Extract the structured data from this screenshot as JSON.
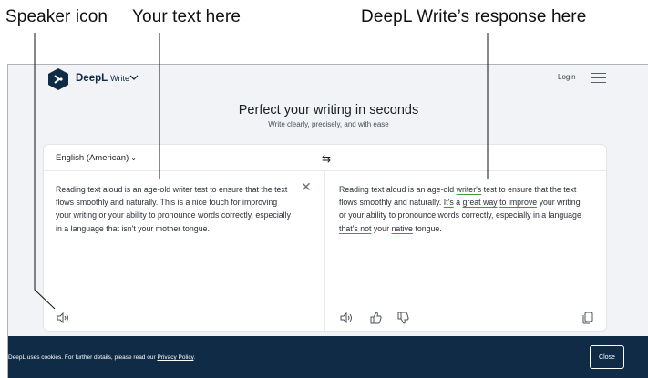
{
  "callouts": {
    "speaker_icon": "Speaker icon",
    "your_text": "Your text here",
    "response": "DeepL Write’s response here"
  },
  "header": {
    "brand": "DeepL",
    "product": "Write",
    "login": "Login"
  },
  "hero": {
    "title": "Perfect your writing in seconds",
    "subtitle": "Write clearly, precisely, and with ease"
  },
  "editor": {
    "language": "English (American)",
    "swap_icon": "swap-arrows",
    "source_text": "Reading text aloud is an age-old writer test to ensure that the text flows smoothly and naturally. This is a nice touch for improving your writing or your ability to pronounce words correctly, especially in a language that isn't your mother tongue.",
    "output_segments": [
      {
        "text": "Reading text aloud is an age-old ",
        "changed": false
      },
      {
        "text": "writer's",
        "changed": true
      },
      {
        "text": " test to ensure that the text flows smoothly and naturally. ",
        "changed": false
      },
      {
        "text": "It's",
        "changed": true
      },
      {
        "text": " a ",
        "changed": false
      },
      {
        "text": "great way",
        "changed": true
      },
      {
        "text": " ",
        "changed": false
      },
      {
        "text": "to improve",
        "changed": true
      },
      {
        "text": " your writing or your ability to pronounce words correctly, especially in a language ",
        "changed": false
      },
      {
        "text": "that's not",
        "changed": true
      },
      {
        "text": " your ",
        "changed": false
      },
      {
        "text": "native",
        "changed": true
      },
      {
        "text": " tongue.",
        "changed": false
      }
    ],
    "icons": [
      "speaker-icon",
      "thumbs-up-icon",
      "thumbs-down-icon",
      "copy-icon",
      "close-icon"
    ]
  },
  "cookie": {
    "text": "DeepL uses cookies. For further details, please read our ",
    "link": "Privacy Policy",
    "end": ".",
    "close": "Close"
  },
  "colors": {
    "brand_navy": "#0f2b46",
    "highlight_green": "#3f9c35",
    "page_bg": "#f1f3f6"
  }
}
